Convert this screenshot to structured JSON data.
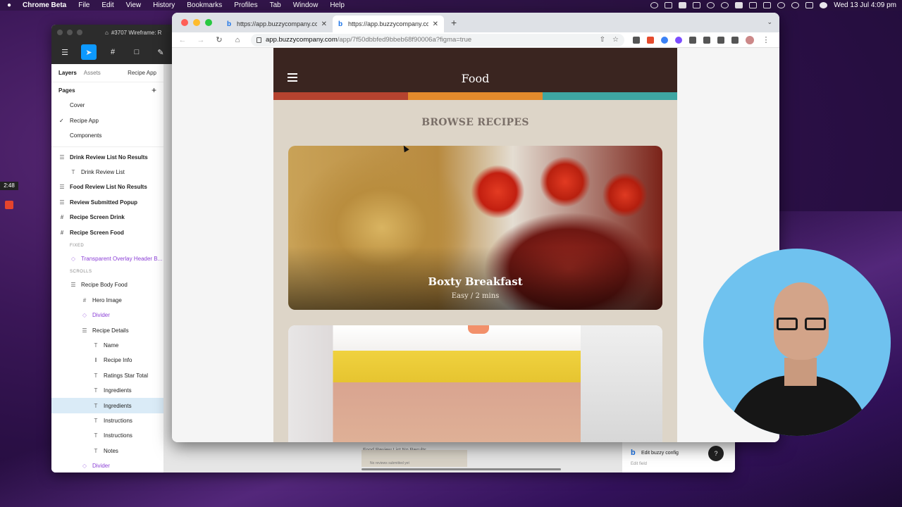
{
  "menubar": {
    "app_name": "Chrome Beta",
    "items": [
      "File",
      "Edit",
      "View",
      "History",
      "Bookmarks",
      "Profiles",
      "Tab",
      "Window",
      "Help"
    ],
    "datetime": "Wed 13 Jul  4:09 pm"
  },
  "recording": {
    "timer": "2:48"
  },
  "figma": {
    "tab_title": "#3707 Wireframe: R",
    "sidebar_tabs": {
      "layers": "Layers",
      "assets": "Assets",
      "page_menu": "Recipe App"
    },
    "pages_label": "Pages",
    "pages": [
      {
        "label": "Cover",
        "checked": false
      },
      {
        "label": "Recipe App",
        "checked": true
      },
      {
        "label": "Components",
        "checked": false
      }
    ],
    "layers": [
      {
        "label": "Drink Review List No Results",
        "icon": "frame-icon",
        "style": "bold",
        "indent": 0
      },
      {
        "label": "Drink Review List",
        "icon": "text-icon",
        "style": "normal",
        "indent": 1
      },
      {
        "label": "Food Review List No Results",
        "icon": "frame-icon",
        "style": "bold",
        "indent": 0
      },
      {
        "label": "Review Submitted Popup",
        "icon": "frame-icon",
        "style": "bold",
        "indent": 0
      },
      {
        "label": "Recipe Screen Drink",
        "icon": "grid-icon",
        "style": "bold",
        "indent": 0
      },
      {
        "label": "Recipe Screen Food",
        "icon": "grid-icon",
        "style": "bold",
        "indent": 0
      },
      {
        "label": "FIXED",
        "icon": "",
        "style": "section",
        "indent": 1
      },
      {
        "label": "Transparent Overlay Header B...",
        "icon": "component-icon",
        "style": "purple",
        "indent": 1
      },
      {
        "label": "SCROLLS",
        "icon": "",
        "style": "section",
        "indent": 1
      },
      {
        "label": "Recipe Body Food",
        "icon": "frame-icon",
        "style": "normal",
        "indent": 1
      },
      {
        "label": "Hero Image",
        "icon": "grid-icon",
        "style": "normal",
        "indent": 2
      },
      {
        "label": "Divider",
        "icon": "component-icon",
        "style": "purple",
        "indent": 2
      },
      {
        "label": "Recipe Details",
        "icon": "frame-icon",
        "style": "normal",
        "indent": 2
      },
      {
        "label": "Name",
        "icon": "text-icon",
        "style": "normal",
        "indent": 3
      },
      {
        "label": "Recipe Info",
        "icon": "columns-icon",
        "style": "normal",
        "indent": 3
      },
      {
        "label": "Ratings Star Total",
        "icon": "text-icon",
        "style": "normal",
        "indent": 3
      },
      {
        "label": "Ingredients",
        "icon": "text-icon",
        "style": "normal",
        "indent": 3
      },
      {
        "label": "Ingredients",
        "icon": "text-icon",
        "style": "selected",
        "indent": 3
      },
      {
        "label": "Instructions",
        "icon": "text-icon",
        "style": "normal",
        "indent": 3
      },
      {
        "label": "Instructions",
        "icon": "text-icon",
        "style": "normal",
        "indent": 3
      },
      {
        "label": "Notes",
        "icon": "text-icon",
        "style": "normal",
        "indent": 3
      },
      {
        "label": "Divider",
        "icon": "component-icon",
        "style": "purple",
        "indent": 2
      }
    ],
    "canvas_frame_title": "Food Review List No Results",
    "canvas_frame_text": "No reviews submitted yet",
    "buzzy_config": {
      "label": "Edit buzzy config",
      "sub_label": "Edit field"
    },
    "help_label": "?"
  },
  "chrome": {
    "tabs": [
      {
        "title": "https://app.buzzycompany.com",
        "active": false
      },
      {
        "title": "https://app.buzzycompany.com",
        "active": true
      }
    ],
    "url_host": "app.buzzycompany.com",
    "url_path": "/app/7f50dbbfed9bbeb68f90006a?figma=true"
  },
  "app": {
    "title": "Food",
    "section_title": "BROWSE RECIPES",
    "stripe_colors": [
      "#b5432f",
      "#e28a2c",
      "#3ea6a2"
    ],
    "header_color": "#3a2520",
    "recipes": [
      {
        "name": "Boxty Breakfast",
        "meta": "Easy / 2 mins"
      },
      {
        "name": "",
        "meta": ""
      }
    ]
  }
}
